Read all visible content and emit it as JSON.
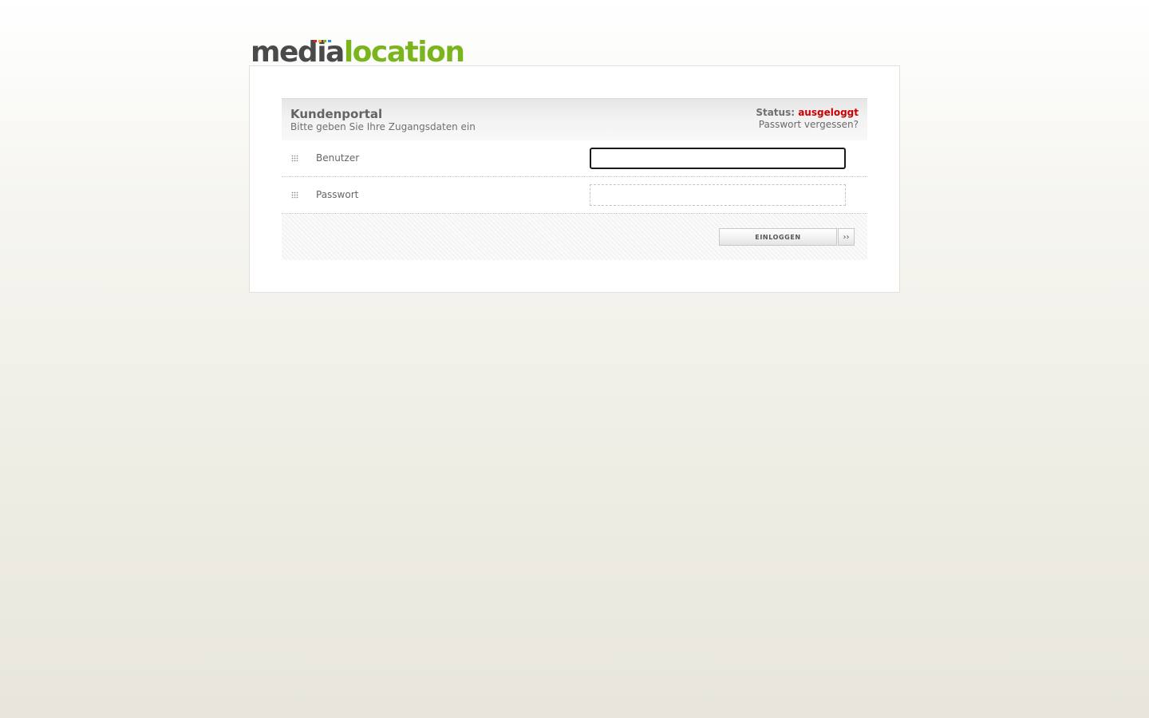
{
  "logo": {
    "part1": "media",
    "part2": "location",
    "color_dark": "#4a4a4a",
    "color_green": "#7ab51d",
    "bar_colors": [
      "#e02020",
      "#f5a623",
      "#7ab51d",
      "#2a8fd8"
    ]
  },
  "panel": {
    "title": "Kundenportal",
    "subtitle": "Bitte geben Sie Ihre Zugangsdaten ein",
    "status_label": "Status:",
    "status_value": "ausgeloggt",
    "status_color": "#cc0000",
    "forgot_password": "Passwort vergessen?"
  },
  "form": {
    "username": {
      "label": "Benutzer",
      "value": "",
      "focused": true
    },
    "password": {
      "label": "Passwort",
      "value": ""
    },
    "submit_label": "EINLOGGEN",
    "arrow_icon": "double-chevron-right-icon",
    "arrow_glyph": "››"
  }
}
